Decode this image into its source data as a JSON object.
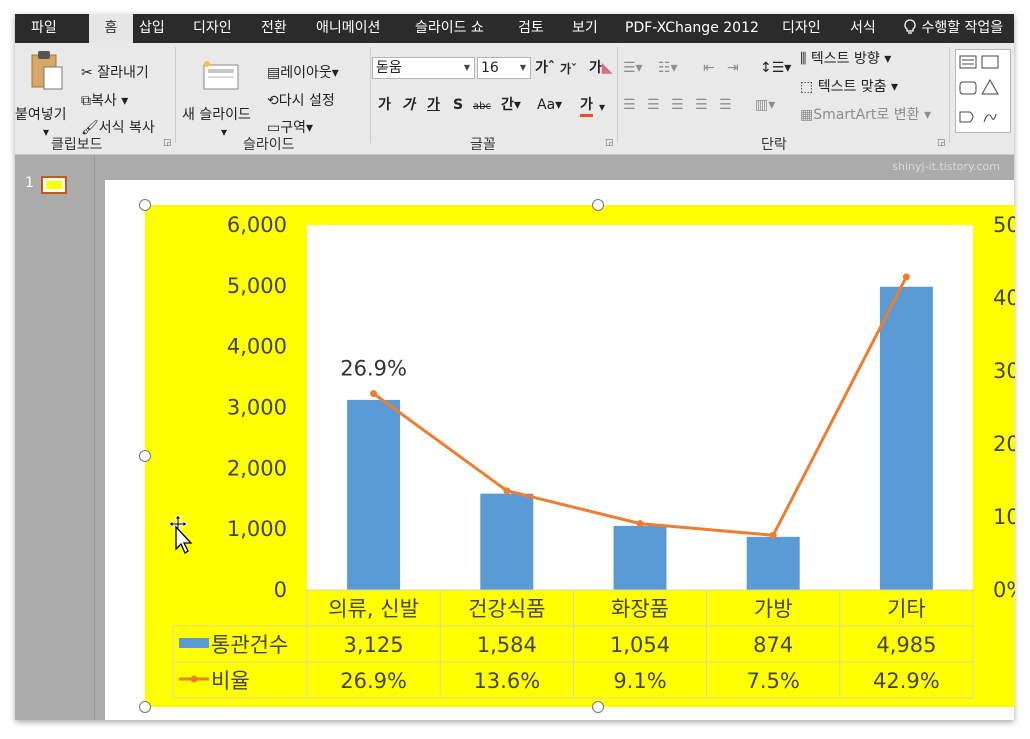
{
  "tabs": {
    "file": "파일",
    "home": "홈",
    "insert": "삽입",
    "design": "디자인",
    "transitions": "전환",
    "animations": "애니메이션",
    "slideshow": "슬라이드 쇼",
    "review": "검토",
    "view": "보기",
    "pdfx": "PDF-XChange 2012",
    "chart_design": "디자인",
    "format": "서식",
    "tell_me": "수행할 작업을"
  },
  "clipboard": {
    "paste": "붙여넣기",
    "cut": "잘라내기",
    "copy": "복사",
    "format_painter": "서식 복사",
    "group": "클립보드"
  },
  "slides_group": {
    "new_slide": "새 슬라이드",
    "layout": "레이아웃",
    "reset": "다시 설정",
    "section": "구역",
    "group": "슬라이드"
  },
  "font_group": {
    "font_name": "돋움",
    "font_size": "16",
    "bold": "가",
    "italic": "가",
    "underline": "가",
    "shadow": "S",
    "strike": "abc",
    "spacing": "간",
    "case": "Aa",
    "color": "가",
    "grow": "가",
    "shrink": "가",
    "clear": "가",
    "group": "글꼴"
  },
  "paragraph_group": {
    "text_direction": "텍스트 방향",
    "align_text": "텍스트 맞춤",
    "smartart": "SmartArt로 변환",
    "group": "단락"
  },
  "thumb": {
    "number": "1"
  },
  "watermark": "shinyj-it.tistory.com",
  "colors": {
    "tabbar": "#2b2b2b",
    "ribbon": "#e9e9e9",
    "bar": "#5b9bd5",
    "line": "#ed7d31",
    "chart_bg": "#ffff00",
    "plot_bg": "#ffffff",
    "selection": "#c55a11"
  },
  "chart_data": {
    "type": "bar",
    "categories": [
      "의류, 신발",
      "건강식품",
      "화장품",
      "가방",
      "기타"
    ],
    "series": [
      {
        "name": "통관건수",
        "type": "bar",
        "axis": "left",
        "values": [
          3125,
          1584,
          1054,
          874,
          4985
        ],
        "labels": [
          "3,125",
          "1,584",
          "1,054",
          "874",
          "4,985"
        ]
      },
      {
        "name": "비율",
        "type": "line",
        "axis": "right",
        "values": [
          26.9,
          13.6,
          9.1,
          7.5,
          42.9
        ],
        "labels": [
          "26.9%",
          "13.6%",
          "9.1%",
          "7.5%",
          "42.9%"
        ]
      }
    ],
    "ylim": [
      0,
      6000
    ],
    "yticks": [
      "0",
      "1,000",
      "2,000",
      "3,000",
      "4,000",
      "5,000",
      "6,000"
    ],
    "y2lim": [
      0,
      50
    ],
    "y2ticks": [
      "0%",
      "10",
      "20",
      "30",
      "40",
      "50"
    ],
    "data_label": "26.9%",
    "data_table": true,
    "legend": "data table"
  }
}
